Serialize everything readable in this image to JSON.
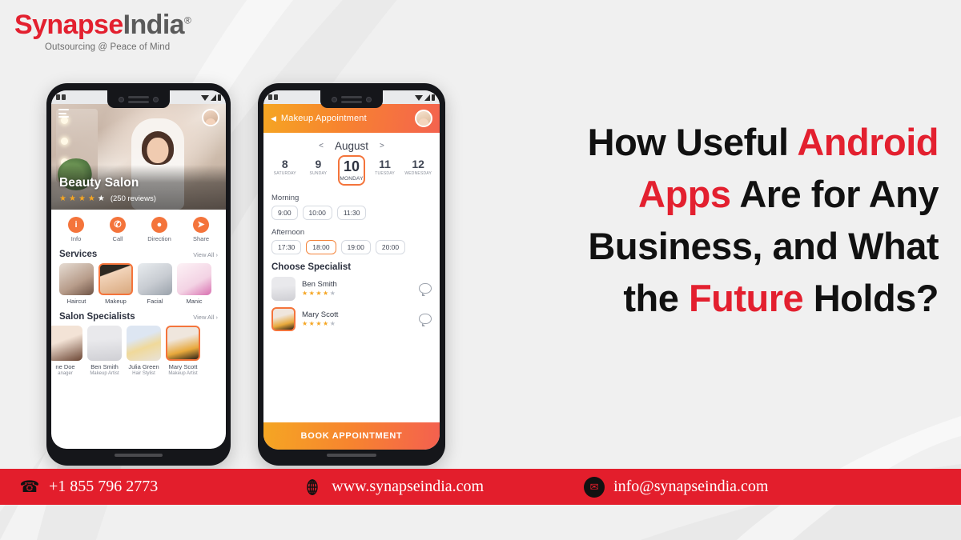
{
  "brand": {
    "name_first": "Synapse",
    "name_second": "India",
    "registered": "®",
    "tagline": "Outsourcing @ Peace of Mind",
    "red": "#e3202f",
    "gray": "#5a5a5a"
  },
  "headline": {
    "line1_a": "How Useful ",
    "line1_b": "Android",
    "line2_a": "Apps",
    "line2_b": " Are for Any",
    "line3": "Business, and What",
    "line4_a": "the ",
    "line4_b": "Future",
    "line4_c": " Holds?",
    "accent": "#e3202f"
  },
  "phone_left": {
    "hero": {
      "title": "Beauty Salon",
      "reviews": "(250 reviews)",
      "stars_filled": 4,
      "stars_total": 5,
      "menu_icon": "hamburger-icon",
      "avatar_icon": "user-avatar"
    },
    "actions": [
      {
        "label": "Info",
        "icon": "info-icon",
        "glyph": "i"
      },
      {
        "label": "Call",
        "icon": "phone-icon",
        "glyph": "✆"
      },
      {
        "label": "Direction",
        "icon": "location-pin-icon",
        "glyph": "●"
      },
      {
        "label": "Share",
        "icon": "share-icon",
        "glyph": "➤"
      }
    ],
    "services": {
      "title": "Services",
      "view_all": "View All",
      "chevron": "›",
      "items": [
        {
          "label": "Haircut",
          "selected": false
        },
        {
          "label": "Makeup",
          "selected": true
        },
        {
          "label": "Facial",
          "selected": false
        },
        {
          "label": "Manic",
          "selected": false
        }
      ]
    },
    "specialists": {
      "title": "Salon Specialists",
      "view_all": "View All",
      "chevron": "›",
      "items": [
        {
          "name": "ne Doe",
          "role": "anager",
          "selected": false
        },
        {
          "name": "Ben Smith",
          "role": "Makeup Artist",
          "selected": false
        },
        {
          "name": "Julia Green",
          "role": "Hair Stylist",
          "selected": false
        },
        {
          "name": "Mary Scott",
          "role": "Makeup Artist",
          "selected": true
        }
      ]
    }
  },
  "phone_right": {
    "appbar": {
      "back_icon": "back-arrow-icon",
      "back_glyph": "◀",
      "title": "Makeup Appointment",
      "avatar_icon": "user-avatar"
    },
    "calendar": {
      "prev": "<",
      "month": "August",
      "next": ">",
      "days": [
        {
          "num": "8",
          "name": "SATURDAY",
          "selected": false
        },
        {
          "num": "9",
          "name": "SUNDAY",
          "selected": false
        },
        {
          "num": "10",
          "name": "MONDAY",
          "selected": true
        },
        {
          "num": "11",
          "name": "TUESDAY",
          "selected": false
        },
        {
          "num": "12",
          "name": "WEDNESDAY",
          "selected": false
        }
      ]
    },
    "morning": {
      "label": "Morning",
      "slots": [
        {
          "time": "9:00",
          "selected": false
        },
        {
          "time": "10:00",
          "selected": false
        },
        {
          "time": "11:30",
          "selected": false
        }
      ]
    },
    "afternoon": {
      "label": "Afternoon",
      "slots": [
        {
          "time": "17:30",
          "selected": false
        },
        {
          "time": "18:00",
          "selected": true
        },
        {
          "time": "19:00",
          "selected": false
        },
        {
          "time": "20:00",
          "selected": false
        }
      ]
    },
    "specialists": {
      "title": "Choose Specialist",
      "items": [
        {
          "name": "Ben Smith",
          "stars_filled": 4,
          "stars_total": 5,
          "selected": false,
          "chat_icon": "chat-bubble-icon"
        },
        {
          "name": "Mary Scott",
          "stars_filled": 4,
          "stars_total": 5,
          "selected": true,
          "chat_icon": "chat-bubble-icon"
        }
      ]
    },
    "book_button": "BOOK APPOINTMENT"
  },
  "footer": {
    "bg": "#e31e2c",
    "phone": {
      "icon": "phone-icon",
      "glyph": "☎",
      "text": "+1 855 796 2773"
    },
    "website": {
      "icon": "globe-icon",
      "glyph": "♁",
      "text": "www.synapseindia.com"
    },
    "email": {
      "icon": "envelope-icon",
      "glyph": "✉",
      "text": "info@synapseindia.com"
    }
  }
}
